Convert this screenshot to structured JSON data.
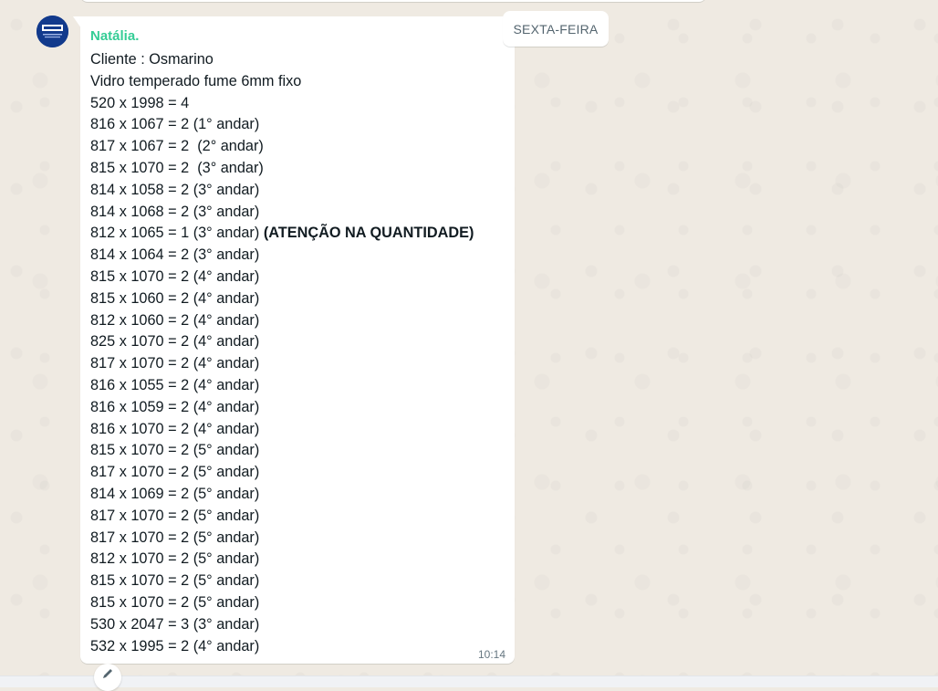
{
  "chat": {
    "date_label": "SEXTA-FEIRA",
    "message": {
      "sender": "Natália.",
      "time": "10:14",
      "lines": [
        {
          "text": "Cliente : Osmarino",
          "bold": ""
        },
        {
          "text": "Vidro temperado fume 6mm fixo",
          "bold": ""
        },
        {
          "text": "520 x 1998 = 4",
          "bold": ""
        },
        {
          "text": "816 x 1067 = 2 (1° andar)",
          "bold": ""
        },
        {
          "text": "817 x 1067 = 2  (2° andar)",
          "bold": ""
        },
        {
          "text": "815 x 1070 = 2  (3° andar)",
          "bold": ""
        },
        {
          "text": "814 x 1058 = 2 (3° andar)",
          "bold": ""
        },
        {
          "text": "814 x 1068 = 2 (3° andar)",
          "bold": ""
        },
        {
          "text": "812 x 1065 = 1 (3° andar) ",
          "bold": "(ATENÇÃO NA QUANTIDADE)"
        },
        {
          "text": "814 x 1064 = 2 (3° andar)",
          "bold": ""
        },
        {
          "text": "815 x 1070 = 2 (4° andar)",
          "bold": ""
        },
        {
          "text": "815 x 1060 = 2 (4° andar)",
          "bold": ""
        },
        {
          "text": "812 x 1060 = 2 (4° andar)",
          "bold": ""
        },
        {
          "text": "825 x 1070 = 2 (4° andar)",
          "bold": ""
        },
        {
          "text": "817 x 1070 = 2 (4° andar)",
          "bold": ""
        },
        {
          "text": "816 x 1055 = 2 (4° andar)",
          "bold": ""
        },
        {
          "text": "816 x 1059 = 2 (4° andar)",
          "bold": ""
        },
        {
          "text": "816 x 1070 = 2 (4° andar)",
          "bold": ""
        },
        {
          "text": "815 x 1070 = 2 (5° andar)",
          "bold": ""
        },
        {
          "text": "817 x 1070 = 2 (5° andar)",
          "bold": ""
        },
        {
          "text": "814 x 1069 = 2 (5° andar)",
          "bold": ""
        },
        {
          "text": "817 x 1070 = 2 (5° andar)",
          "bold": ""
        },
        {
          "text": "817 x 1070 = 2 (5° andar)",
          "bold": ""
        },
        {
          "text": "812 x 1070 = 2 (5° andar)",
          "bold": ""
        },
        {
          "text": "815 x 1070 = 2 (5° andar)",
          "bold": ""
        },
        {
          "text": "815 x 1070 = 2 (5° andar)",
          "bold": ""
        },
        {
          "text": "530 x 2047 = 3 (3° andar)",
          "bold": ""
        },
        {
          "text": "532 x 1995 = 2 (4° andar)",
          "bold": ""
        }
      ]
    }
  },
  "colors": {
    "chat_background": "#efeae2",
    "bubble": "#ffffff",
    "sender_name": "#35cd96",
    "message_text": "#111b21",
    "timestamp": "#667781",
    "avatar": "#123a8c"
  },
  "icons": {
    "avatar": "company-logo-avatar",
    "footer_action": "pencil-icon"
  }
}
